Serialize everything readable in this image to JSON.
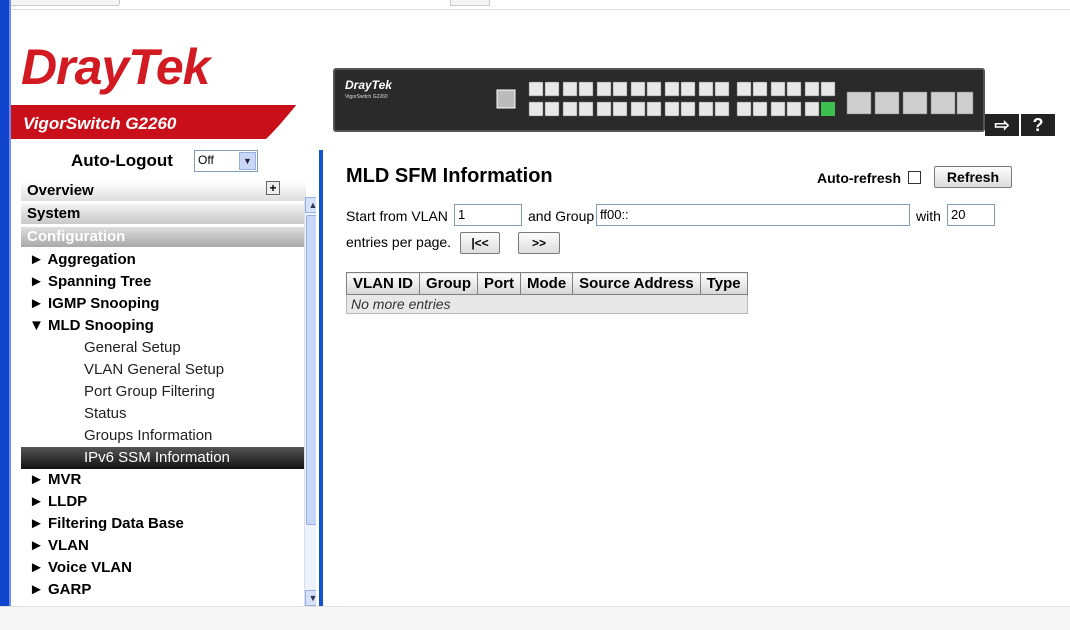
{
  "brand": {
    "logo_part1": "Dray",
    "logo_part2": "Tek",
    "model": "VigorSwitch G2260",
    "device_logo": "DrayTek",
    "device_sub": "VigorSwitch G2260",
    "colors": {
      "accent": "#d11a22",
      "nav_blue": "#1155cc"
    }
  },
  "header_icons": [
    "logout-icon",
    "help-icon"
  ],
  "sidebar": {
    "autologout_label": "Auto-Logout",
    "autologout_value": "Off",
    "sections": {
      "overview": "Overview",
      "system": "System",
      "configuration": "Configuration"
    },
    "items": [
      {
        "label": "► Aggregation",
        "type": "group"
      },
      {
        "label": "► Spanning Tree",
        "type": "group"
      },
      {
        "label": "► IGMP Snooping",
        "type": "group"
      },
      {
        "label": "▼ MLD Snooping",
        "type": "group"
      },
      {
        "label": "General Setup",
        "type": "sub"
      },
      {
        "label": "VLAN General Setup",
        "type": "sub"
      },
      {
        "label": "Port Group Filtering",
        "type": "sub"
      },
      {
        "label": "Status",
        "type": "sub"
      },
      {
        "label": "Groups Information",
        "type": "sub"
      },
      {
        "label": "IPv6 SSM Information",
        "type": "sub",
        "active": true
      },
      {
        "label": "► MVR",
        "type": "group"
      },
      {
        "label": "► LLDP",
        "type": "group"
      },
      {
        "label": "► Filtering Data Base",
        "type": "group"
      },
      {
        "label": "► VLAN",
        "type": "group"
      },
      {
        "label": "► Voice VLAN",
        "type": "group"
      },
      {
        "label": "► GARP",
        "type": "group"
      }
    ]
  },
  "main": {
    "title": "MLD SFM Information",
    "auto_refresh_label": "Auto-refresh",
    "auto_refresh_checked": false,
    "refresh_label": "Refresh",
    "start_label": "Start from VLAN",
    "vlan_value": "1",
    "group_label": "and Group",
    "group_value": "ff00::",
    "with_label": "with",
    "entries_value": "20",
    "entries_label": "entries per page.",
    "first_label": "|<<",
    "next_label": ">>",
    "table": {
      "headers": [
        "VLAN ID",
        "Group",
        "Port",
        "Mode",
        "Source Address",
        "Type"
      ],
      "empty_text": "No more entries"
    }
  }
}
